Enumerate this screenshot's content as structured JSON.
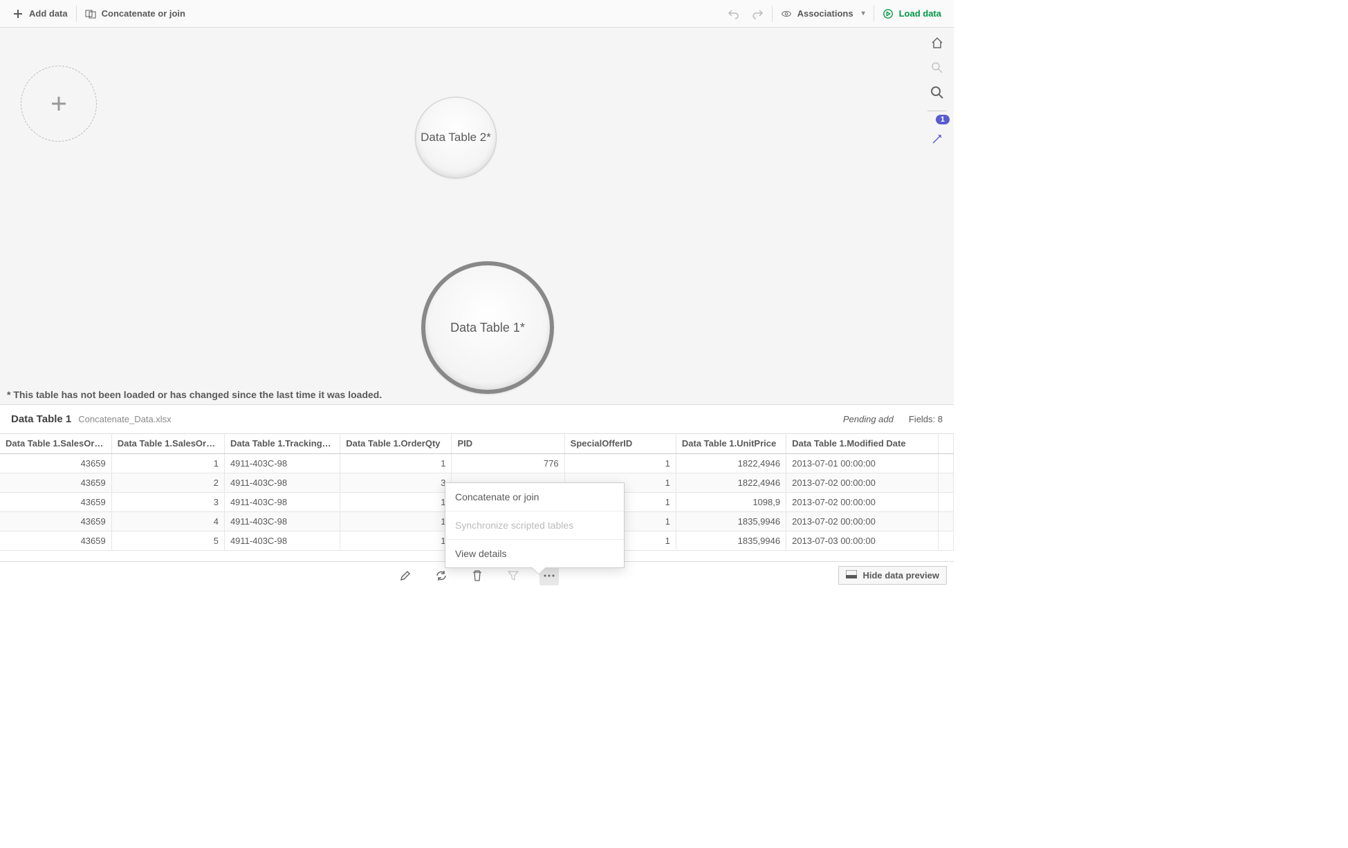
{
  "toolbar": {
    "add_data": "Add data",
    "concat_join": "Concatenate or join",
    "associations": "Associations",
    "load_data": "Load data"
  },
  "canvas": {
    "bubble_small": "Data Table 2*",
    "bubble_large": "Data Table 1*",
    "note": "* This table has not been loaded or has changed since the last time it was loaded.",
    "badge": "1"
  },
  "preview": {
    "title": "Data Table 1",
    "file": "Concatenate_Data.xlsx",
    "pending": "Pending add",
    "fields": "Fields: 8",
    "columns": [
      "Data Table 1.SalesOr…",
      "Data Table 1.SalesOr…",
      "Data Table 1.Tracking…",
      "Data Table 1.OrderQty",
      "PID",
      "SpecialOfferID",
      "Data Table 1.UnitPrice",
      "Data Table 1.Modified Date"
    ],
    "rows": [
      [
        "43659",
        "1",
        "4911-403C-98",
        "1",
        "776",
        "1",
        "1822,4946",
        "2013-07-01 00:00:00"
      ],
      [
        "43659",
        "2",
        "4911-403C-98",
        "3",
        "",
        "1",
        "1822,4946",
        "2013-07-02 00:00:00"
      ],
      [
        "43659",
        "3",
        "4911-403C-98",
        "1",
        "",
        "1",
        "1098,9",
        "2013-07-02 00:00:00"
      ],
      [
        "43659",
        "4",
        "4911-403C-98",
        "1",
        "",
        "1",
        "1835,9946",
        "2013-07-02 00:00:00"
      ],
      [
        "43659",
        "5",
        "4911-403C-98",
        "1",
        "",
        "1",
        "1835,9946",
        "2013-07-03 00:00:00"
      ]
    ],
    "col_align": [
      "num",
      "num",
      "",
      "num",
      "num",
      "num",
      "num",
      ""
    ]
  },
  "context_menu": {
    "items": [
      {
        "label": "Concatenate or join",
        "disabled": false
      },
      {
        "label": "Synchronize scripted tables",
        "disabled": true
      },
      {
        "label": "View details",
        "disabled": false
      }
    ]
  },
  "bottom": {
    "hide_preview": "Hide data preview"
  }
}
